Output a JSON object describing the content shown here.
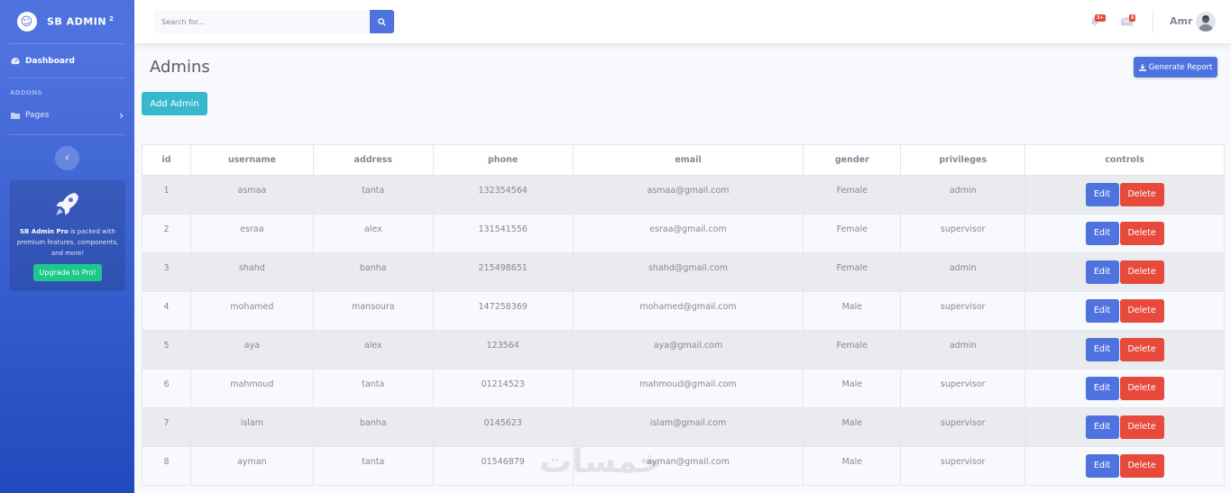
{
  "sidebar": {
    "brand": "SB ADMIN",
    "brand_sup": "2",
    "dashboard_label": "Dashboard",
    "addons_heading": "ADDONS",
    "pages_label": "Pages",
    "promo_bold": "SB Admin Pro",
    "promo_text": " is packed with premium features, components, and more!",
    "upgrade_label": "Upgrade to Pro!"
  },
  "topbar": {
    "search_placeholder": "Search for...",
    "alerts_badge": "3+",
    "messages_badge": "5",
    "user_name": "Amr"
  },
  "main": {
    "title": "Admins",
    "generate_report_label": "Generate Report",
    "add_admin_label": "Add Admin"
  },
  "table": {
    "headers": [
      "id",
      "username",
      "address",
      "phone",
      "email",
      "gender",
      "privileges",
      "controls"
    ],
    "edit_label": "Edit",
    "delete_label": "Delete",
    "rows": [
      {
        "id": "1",
        "username": "asmaa",
        "address": "tanta",
        "phone": "132354564",
        "email": "asmaa@gmail.com",
        "gender": "Female",
        "privileges": "admin"
      },
      {
        "id": "2",
        "username": "esraa",
        "address": "alex",
        "phone": "131541556",
        "email": "esraa@gmail.com",
        "gender": "Female",
        "privileges": "supervisor"
      },
      {
        "id": "3",
        "username": "shahd",
        "address": "banha",
        "phone": "215498651",
        "email": "shahd@gmail.com",
        "gender": "Female",
        "privileges": "admin"
      },
      {
        "id": "4",
        "username": "mohamed",
        "address": "mansoura",
        "phone": "147258369",
        "email": "mohamed@gmail.com",
        "gender": "Male",
        "privileges": "supervisor"
      },
      {
        "id": "5",
        "username": "aya",
        "address": "alex",
        "phone": "123564",
        "email": "aya@gmail.com",
        "gender": "Female",
        "privileges": "admin"
      },
      {
        "id": "6",
        "username": "mahmoud",
        "address": "tanta",
        "phone": "01214523",
        "email": "mahmoud@gmail.com",
        "gender": "Male",
        "privileges": "supervisor"
      },
      {
        "id": "7",
        "username": "islam",
        "address": "banha",
        "phone": "0145623",
        "email": "islam@gmail.com",
        "gender": "Male",
        "privileges": "supervisor"
      },
      {
        "id": "8",
        "username": "ayman",
        "address": "tanta",
        "phone": "01546879",
        "email": "ayman@gmail.com",
        "gender": "Male",
        "privileges": "supervisor"
      }
    ]
  },
  "watermark": "خمسات",
  "colors": {
    "primary": "#4e73df",
    "danger": "#e74a3b",
    "info": "#36b9cc",
    "success": "#1cc88a"
  }
}
